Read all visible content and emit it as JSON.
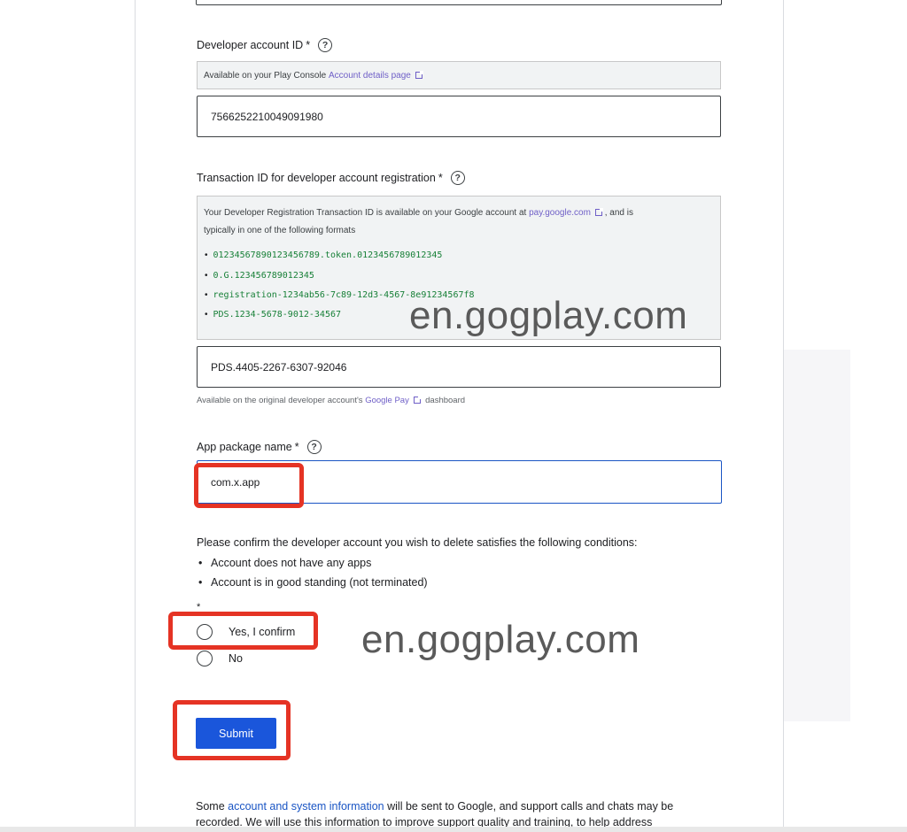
{
  "dev_account": {
    "label": "Developer account ID",
    "required_mark": "*",
    "info_prefix": "Available on your Play Console",
    "info_link": "Account details page",
    "value": "7566252210049091980"
  },
  "transaction": {
    "label": "Transaction ID for developer account registration",
    "required_mark": "*",
    "info_line1_prefix": "Your Developer Registration Transaction ID is available on your Google account at",
    "info_link": "pay.google.com",
    "info_line1_suffix": ", and is",
    "info_line2": "typically in one of the following formats",
    "formats": [
      "01234567890123456789.token.0123456789012345",
      "0.G.123456789012345",
      "registration-1234ab56-7c89-12d3-4567-8e91234567f8",
      "PDS.1234-5678-9012-34567"
    ],
    "value": "PDS.4405-2267-6307-92046",
    "note_prefix": "Available on the original developer account's",
    "note_link": "Google Pay",
    "note_suffix": "dashboard"
  },
  "package": {
    "label": "App package name",
    "required_mark": "*",
    "value": "com.x.app"
  },
  "conditions": {
    "intro": "Please confirm the developer account you wish to delete satisfies the following conditions:",
    "items": [
      "Account does not have any apps",
      "Account is in good standing (not terminated)"
    ],
    "required_mark": "*",
    "options": [
      "Yes, I confirm",
      "No"
    ]
  },
  "submit_label": "Submit",
  "footer": {
    "line1_prefix": "Some",
    "line1_link": "account and system information",
    "line1_suffix": "will be sent to Google, and support calls and chats may be",
    "line2": "recorded. We will use this information to improve support quality and training, to help address"
  },
  "watermark": "en.gogplay.com",
  "help_glyph": "?",
  "icons": [
    "help-circle-icon",
    "external-link-icon",
    "radio-unchecked-icon"
  ],
  "colors": {
    "link": "#6f5fc7",
    "link_blue": "#1a55c4",
    "mono_green": "#188038",
    "submit_bg": "#1a56db",
    "highlight_red": "#e53324"
  }
}
